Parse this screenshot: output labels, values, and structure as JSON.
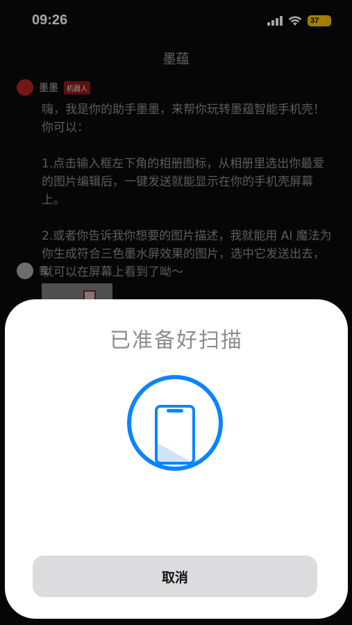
{
  "status_bar": {
    "time": "09:26",
    "battery": "37",
    "icons": [
      "signal-icon",
      "wifi-icon",
      "battery-icon"
    ]
  },
  "chat": {
    "title": "墨蕴",
    "bot": {
      "name": "墨墨",
      "badge": "机器人",
      "message": "嗨，我是你的助手墨墨，来帮你玩转墨蕴智能手机壳！你可以：\n\n1.点击输入框左下角的相册图标，从相册里选出你最爱的图片编辑后，一键发送就能显示在你的手机壳屏幕上。\n\n2.或者你告诉我你想要的图片描述，我就能用 AI 魔法为你生成符合三色墨水屏效果的图片，选中它发送出去，就可以在屏幕上看到了呦～"
    },
    "user": {
      "name": "我"
    }
  },
  "sheet": {
    "title": "已准备好扫描",
    "cancel_label": "取消"
  },
  "colors": {
    "accent": "#0a84ff",
    "bot_avatar": "#c02525",
    "badge_bg": "#8a1d1d"
  }
}
